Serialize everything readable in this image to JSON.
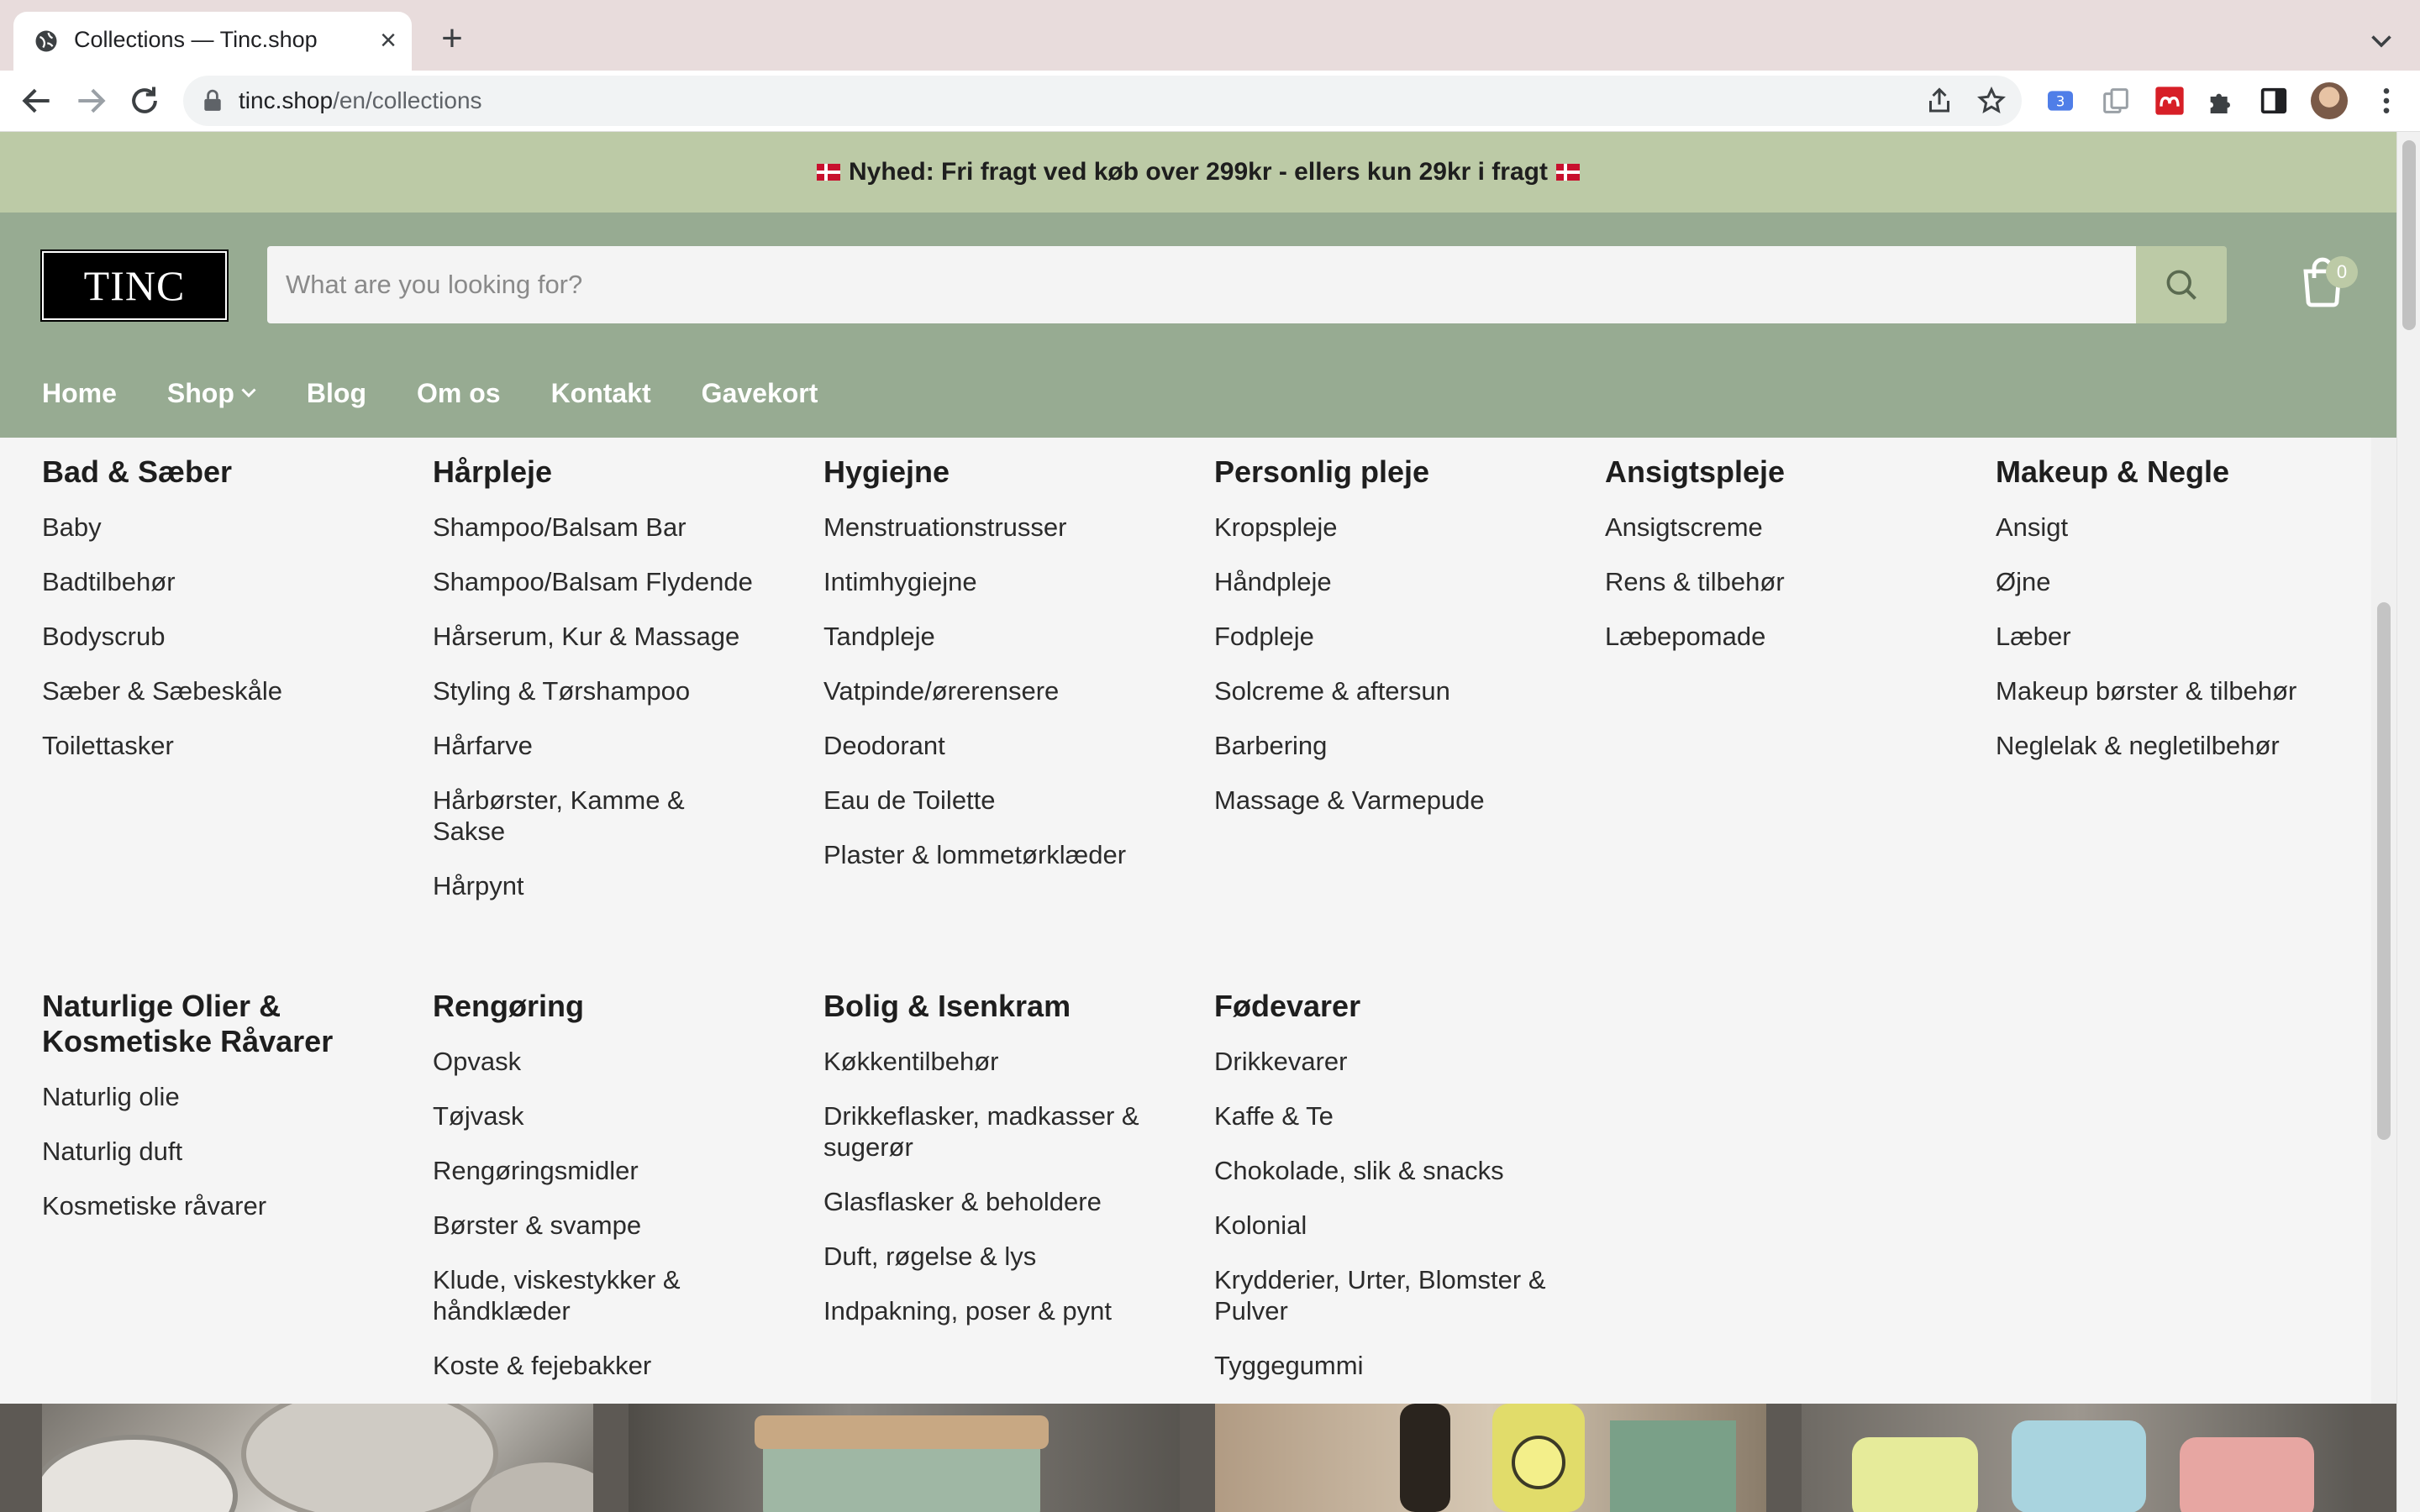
{
  "browser": {
    "tab_title": "Collections — Tinc.shop",
    "url_host": "tinc.shop",
    "url_path": "/en/collections"
  },
  "announcement": {
    "text": "Nyhed: Fri fragt ved køb over 299kr - ellers kun 29kr i fragt"
  },
  "header": {
    "logo_text": "TINC",
    "search_placeholder": "What are you looking for?",
    "cart_count": "0"
  },
  "nav": {
    "items": [
      "Home",
      "Shop",
      "Blog",
      "Om os",
      "Kontakt",
      "Gavekort"
    ]
  },
  "mega_menu": {
    "row1": [
      {
        "title": "Bad & Sæber",
        "links": [
          "Baby",
          "Badtilbehør",
          "Bodyscrub",
          "Sæber & Sæbeskåle",
          "Toilettasker"
        ]
      },
      {
        "title": "Hårpleje",
        "links": [
          "Shampoo/Balsam Bar",
          "Shampoo/Balsam Flydende",
          "Hårserum, Kur & Massage",
          "Styling & Tørshampoo",
          "Hårfarve",
          "Hårbørster, Kamme & Sakse",
          "Hårpynt"
        ]
      },
      {
        "title": "Hygiejne",
        "links": [
          "Menstruationstrusser",
          "Intimhygiejne",
          "Tandpleje",
          "Vatpinde/ørerensere",
          "Deodorant",
          "Eau de Toilette",
          "Plaster & lommetørklæder"
        ]
      },
      {
        "title": "Personlig pleje",
        "links": [
          "Kropspleje",
          "Håndpleje",
          "Fodpleje",
          "Solcreme & aftersun",
          "Barbering",
          "Massage & Varmepude"
        ]
      },
      {
        "title": "Ansigtspleje",
        "links": [
          "Ansigtscreme",
          "Rens & tilbehør",
          "Læbepomade"
        ]
      },
      {
        "title": "Makeup & Negle",
        "links": [
          "Ansigt",
          "Øjne",
          "Læber",
          "Makeup børster & tilbehør",
          "Neglelak & negletilbehør"
        ]
      }
    ],
    "row2": [
      {
        "title": "Naturlige Olier & Kosmetiske Råvarer",
        "links": [
          "Naturlig olie",
          "Naturlig duft",
          "Kosmetiske råvarer"
        ]
      },
      {
        "title": "Rengøring",
        "links": [
          "Opvask",
          "Tøjvask",
          "Rengøringsmidler",
          "Børster & svampe",
          "Klude, viskestykker & håndklæder",
          "Koste & fejebakker"
        ]
      },
      {
        "title": "Bolig & Isenkram",
        "links": [
          "Køkkentilbehør",
          "Drikkeflasker, madkasser & sugerør",
          "Glasflasker & beholdere",
          "Duft, røgelse & lys",
          "Indpakning, poser & pynt"
        ]
      },
      {
        "title": "Fødevarer",
        "links": [
          "Drikkevarer",
          "Kaffe & Te",
          "Chokolade, slik & snacks",
          "Kolonial",
          "Krydderier, Urter, Blomster & Pulver",
          "Tyggegummi"
        ]
      }
    ]
  },
  "colors": {
    "announcement_bg": "#bccaa6",
    "header_bg": "#97ab92",
    "accent": "#bccaa6"
  },
  "icons": [
    "globe-icon",
    "close-icon",
    "plus-icon",
    "back-icon",
    "forward-icon",
    "reload-icon",
    "lock-icon",
    "share-icon",
    "star-icon",
    "search-icon",
    "cart-icon",
    "chevron-down-icon",
    "puzzle-icon",
    "side-panel-icon",
    "kebab-menu-icon"
  ]
}
